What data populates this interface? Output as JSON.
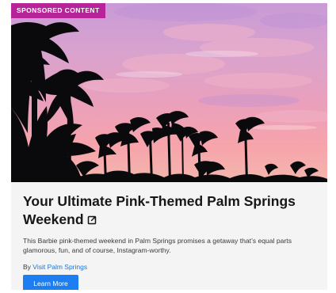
{
  "card": {
    "badge": "SPONSORED CONTENT",
    "title": "Your Ultimate Pink-Themed Palm Springs Weekend",
    "description": "This Barbie pink-themed weekend in Palm Springs promises a getaway that’s equal parts glamorous, fun, and of course, Instagram-worthy.",
    "byline_prefix": "By",
    "sponsor": "Visit Palm Springs",
    "cta": "Learn More",
    "icons": {
      "title_link": "external-link-icon"
    },
    "colors": {
      "badge": "#b7249a",
      "cta": "#1d7ef1",
      "link": "#1677d6"
    }
  }
}
